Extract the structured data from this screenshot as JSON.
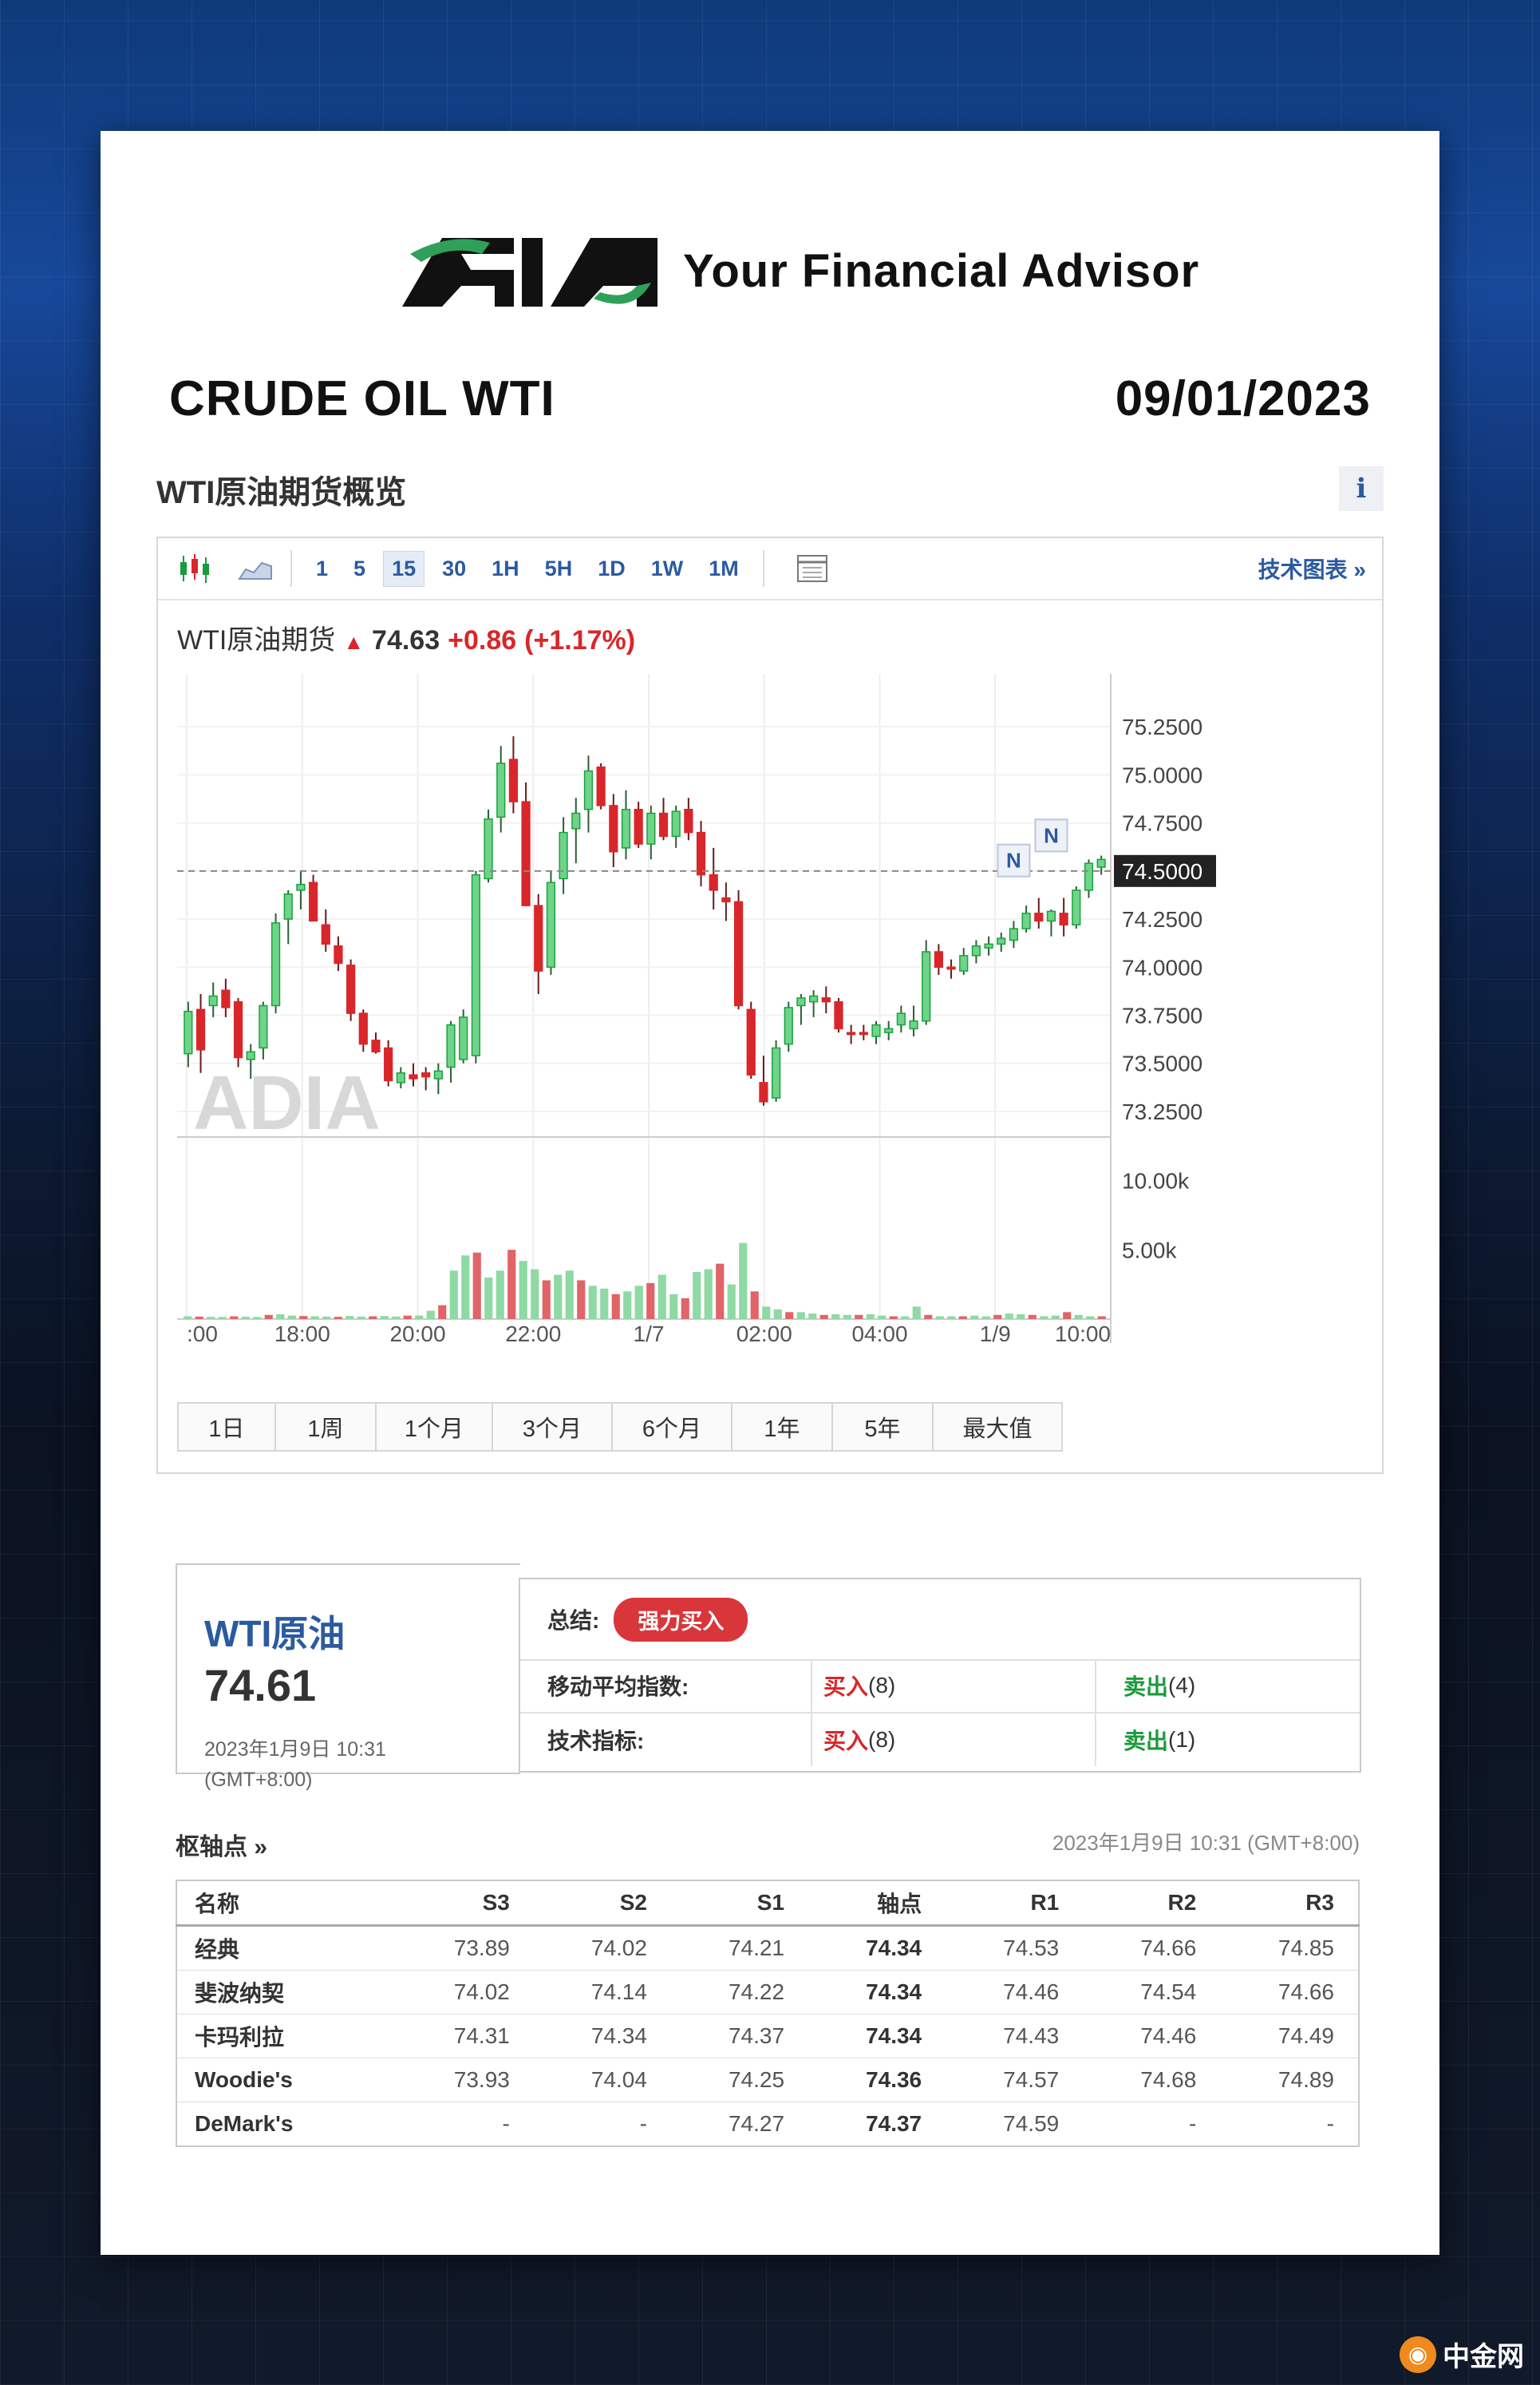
{
  "brand": {
    "tagline": "Your Financial Advisor",
    "logo_text": "ADIA"
  },
  "report": {
    "instrument": "CRUDE OIL WTI",
    "date": "09/01/2023"
  },
  "section_title": "WTI原油期货概览",
  "info_label": "i",
  "toolbar": {
    "intervals": [
      "1",
      "5",
      "15",
      "30",
      "1H",
      "5H",
      "1D",
      "1W",
      "1M"
    ],
    "active_interval": "15",
    "tech_chart_label": "技术图表 »",
    "icons": [
      "candlestick-icon",
      "area-chart-icon",
      "table-icon"
    ]
  },
  "quote": {
    "name": "WTI原油期货",
    "price": "74.63",
    "change": "+0.86",
    "change_pct": "(+1.17%)"
  },
  "chart_data": {
    "type": "candlestick",
    "title": "",
    "price_ticks": [
      "75.2500",
      "75.0000",
      "74.7500",
      "74.5000",
      "74.2500",
      "74.0000",
      "73.7500",
      "73.5000",
      "73.2500"
    ],
    "ylim": [
      73.2,
      75.4
    ],
    "current_price_label": "74.5000",
    "volume_ticks": [
      "10.00k",
      "5.00k"
    ],
    "x_ticks": [
      ":00",
      "18:00",
      "20:00",
      "22:00",
      "1/7",
      "02:00",
      "04:00",
      "1/9",
      "10:00"
    ],
    "watermark": "ADIA",
    "markers": [
      "N",
      "N"
    ],
    "colors": {
      "up": "#1aa33c",
      "down": "#d9262a",
      "up_fill": "#6fd38a",
      "down_fill": "#d9262a"
    },
    "candles": [
      [
        73.55,
        73.82,
        73.48,
        73.77
      ],
      [
        73.78,
        73.86,
        73.45,
        73.57
      ],
      [
        73.8,
        73.92,
        73.74,
        73.85
      ],
      [
        73.88,
        73.94,
        73.74,
        73.79
      ],
      [
        73.82,
        73.84,
        73.48,
        73.53
      ],
      [
        73.52,
        73.6,
        73.42,
        73.56
      ],
      [
        73.58,
        73.82,
        73.52,
        73.8
      ],
      [
        73.8,
        74.28,
        73.76,
        74.23
      ],
      [
        74.25,
        74.4,
        74.12,
        74.38
      ],
      [
        74.4,
        74.5,
        74.3,
        74.43
      ],
      [
        74.44,
        74.48,
        74.26,
        74.24
      ],
      [
        74.22,
        74.3,
        74.08,
        74.12
      ],
      [
        74.11,
        74.16,
        73.98,
        74.02
      ],
      [
        74.01,
        74.04,
        73.72,
        73.76
      ],
      [
        73.76,
        73.78,
        73.56,
        73.6
      ],
      [
        73.62,
        73.66,
        73.55,
        73.56
      ],
      [
        73.58,
        73.62,
        73.38,
        73.41
      ],
      [
        73.4,
        73.48,
        73.37,
        73.45
      ],
      [
        73.44,
        73.5,
        73.38,
        73.42
      ],
      [
        73.45,
        73.48,
        73.36,
        73.43
      ],
      [
        73.42,
        73.5,
        73.34,
        73.46
      ],
      [
        73.48,
        73.72,
        73.4,
        73.7
      ],
      [
        73.52,
        73.78,
        73.5,
        73.74
      ],
      [
        73.54,
        74.5,
        73.5,
        74.48
      ],
      [
        74.46,
        74.82,
        74.44,
        74.77
      ],
      [
        74.78,
        75.15,
        74.7,
        75.06
      ],
      [
        75.08,
        75.2,
        74.8,
        74.86
      ],
      [
        74.86,
        74.96,
        74.32,
        74.32
      ],
      [
        74.32,
        74.38,
        73.86,
        73.98
      ],
      [
        74.0,
        74.5,
        73.96,
        74.44
      ],
      [
        74.46,
        74.78,
        74.38,
        74.7
      ],
      [
        74.72,
        74.88,
        74.54,
        74.8
      ],
      [
        74.82,
        75.1,
        74.7,
        75.02
      ],
      [
        75.04,
        75.06,
        74.82,
        74.84
      ],
      [
        74.84,
        74.9,
        74.52,
        74.6
      ],
      [
        74.62,
        74.92,
        74.56,
        74.82
      ],
      [
        74.82,
        74.86,
        74.62,
        74.64
      ],
      [
        74.64,
        74.84,
        74.56,
        74.8
      ],
      [
        74.8,
        74.88,
        74.66,
        74.68
      ],
      [
        74.68,
        74.84,
        74.62,
        74.81
      ],
      [
        74.82,
        74.88,
        74.66,
        74.7
      ],
      [
        74.7,
        74.76,
        74.42,
        74.48
      ],
      [
        74.48,
        74.62,
        74.3,
        74.4
      ],
      [
        74.36,
        74.44,
        74.24,
        74.34
      ],
      [
        74.34,
        74.4,
        73.78,
        73.8
      ],
      [
        73.78,
        73.82,
        73.42,
        73.44
      ],
      [
        73.4,
        73.54,
        73.28,
        73.3
      ],
      [
        73.32,
        73.62,
        73.3,
        73.58
      ],
      [
        73.6,
        73.82,
        73.56,
        73.79
      ],
      [
        73.8,
        73.86,
        73.7,
        73.84
      ],
      [
        73.82,
        73.88,
        73.74,
        73.85
      ],
      [
        73.84,
        73.9,
        73.76,
        73.82
      ],
      [
        73.82,
        73.84,
        73.66,
        73.68
      ],
      [
        73.66,
        73.7,
        73.6,
        73.65
      ],
      [
        73.66,
        73.7,
        73.62,
        73.65
      ],
      [
        73.64,
        73.72,
        73.6,
        73.7
      ],
      [
        73.66,
        73.72,
        73.62,
        73.68
      ],
      [
        73.7,
        73.8,
        73.66,
        73.76
      ],
      [
        73.68,
        73.8,
        73.64,
        73.72
      ],
      [
        73.72,
        74.14,
        73.7,
        74.08
      ],
      [
        74.08,
        74.12,
        73.96,
        74.0
      ],
      [
        74.0,
        74.04,
        73.94,
        73.99
      ],
      [
        73.98,
        74.1,
        73.96,
        74.06
      ],
      [
        74.06,
        74.14,
        74.02,
        74.11
      ],
      [
        74.1,
        74.16,
        74.06,
        74.12
      ],
      [
        74.12,
        74.18,
        74.08,
        74.15
      ],
      [
        74.14,
        74.24,
        74.1,
        74.2
      ],
      [
        74.2,
        74.32,
        74.18,
        74.28
      ],
      [
        74.28,
        74.36,
        74.2,
        74.24
      ],
      [
        74.24,
        74.3,
        74.16,
        74.29
      ],
      [
        74.28,
        74.36,
        74.16,
        74.22
      ],
      [
        74.22,
        74.42,
        74.2,
        74.4
      ],
      [
        74.4,
        74.56,
        74.36,
        74.54
      ],
      [
        74.52,
        74.58,
        74.48,
        74.56
      ]
    ],
    "volumes": [
      200,
      180,
      160,
      150,
      200,
      170,
      150,
      300,
      350,
      250,
      220,
      200,
      180,
      160,
      220,
      180,
      200,
      220,
      180,
      250,
      250,
      600,
      1000,
      3500,
      4600,
      4800,
      3000,
      3500,
      5000,
      4200,
      3600,
      2800,
      3200,
      3500,
      2800,
      2400,
      2200,
      1800,
      2000,
      2400,
      2600,
      3200,
      1800,
      1500,
      3400,
      3600,
      4000,
      2500,
      5500,
      2000,
      900,
      700,
      500,
      500,
      400,
      300,
      350,
      300,
      300,
      350,
      250,
      200,
      200,
      900,
      300,
      200,
      200,
      200,
      250,
      200,
      300,
      400,
      350,
      300,
      200,
      250,
      500,
      300,
      200,
      200
    ]
  },
  "ranges": [
    "1日",
    "1周",
    "1个月",
    "3个月",
    "6个月",
    "1年",
    "5年",
    "最大值"
  ],
  "summary": {
    "name": "WTI原油",
    "price": "74.61",
    "time": "2023年1月9日 10:31",
    "tz": "(GMT+8:00)",
    "summary_label": "总结:",
    "summary_value": "强力买入",
    "ma_label": "移动平均指数:",
    "ma_buy": "买入",
    "ma_buy_count": "(8)",
    "ma_sell": "卖出",
    "ma_sell_count": "(4)",
    "ti_label": "技术指标:",
    "ti_buy": "买入",
    "ti_buy_count": "(8)",
    "ti_sell": "卖出",
    "ti_sell_count": "(1)"
  },
  "pivot": {
    "title": "枢轴点 »",
    "time": "2023年1月9日 10:31 (GMT+8:00)",
    "headers": [
      "名称",
      "S3",
      "S2",
      "S1",
      "轴点",
      "R1",
      "R2",
      "R3"
    ],
    "rows": [
      [
        "经典",
        "73.89",
        "74.02",
        "74.21",
        "74.34",
        "74.53",
        "74.66",
        "74.85"
      ],
      [
        "斐波纳契",
        "74.02",
        "74.14",
        "74.22",
        "74.34",
        "74.46",
        "74.54",
        "74.66"
      ],
      [
        "卡玛利拉",
        "74.31",
        "74.34",
        "74.37",
        "74.34",
        "74.43",
        "74.46",
        "74.49"
      ],
      [
        "Woodie's",
        "73.93",
        "74.04",
        "74.25",
        "74.36",
        "74.57",
        "74.68",
        "74.89"
      ],
      [
        "DeMark's",
        "-",
        "-",
        "74.27",
        "74.37",
        "74.59",
        "-",
        "-"
      ]
    ]
  },
  "watermark_site": "中金网"
}
